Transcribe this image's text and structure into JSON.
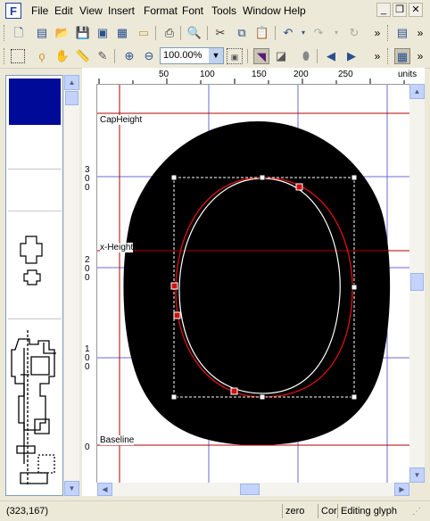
{
  "menubar": {
    "items": [
      "File",
      "Edit",
      "View",
      "Insert",
      "Format",
      "Font",
      "Tools",
      "Window",
      "Help"
    ],
    "app_icon_letter": "F"
  },
  "toolbar2": {
    "zoom_value": "100.00%"
  },
  "ruler": {
    "h_ticks": [
      "50",
      "100",
      "150",
      "200",
      "250"
    ],
    "units_label": "units",
    "v_labels": [
      "3\n0\n0",
      "2\n0\n0",
      "1\n0\n0",
      "0"
    ]
  },
  "guides": {
    "cap_height": "CapHeight",
    "x_height": "x-Height",
    "baseline": "Baseline"
  },
  "status": {
    "coords": "(323,167)",
    "glyph_name": "zero",
    "field3": "Cor",
    "mode": "Editing glyph"
  },
  "colors": {
    "guide_red": "#b00000",
    "grid_blue": "#6b6bd0",
    "selected_glyph": "#000a99",
    "outline_red": "#d01010"
  }
}
